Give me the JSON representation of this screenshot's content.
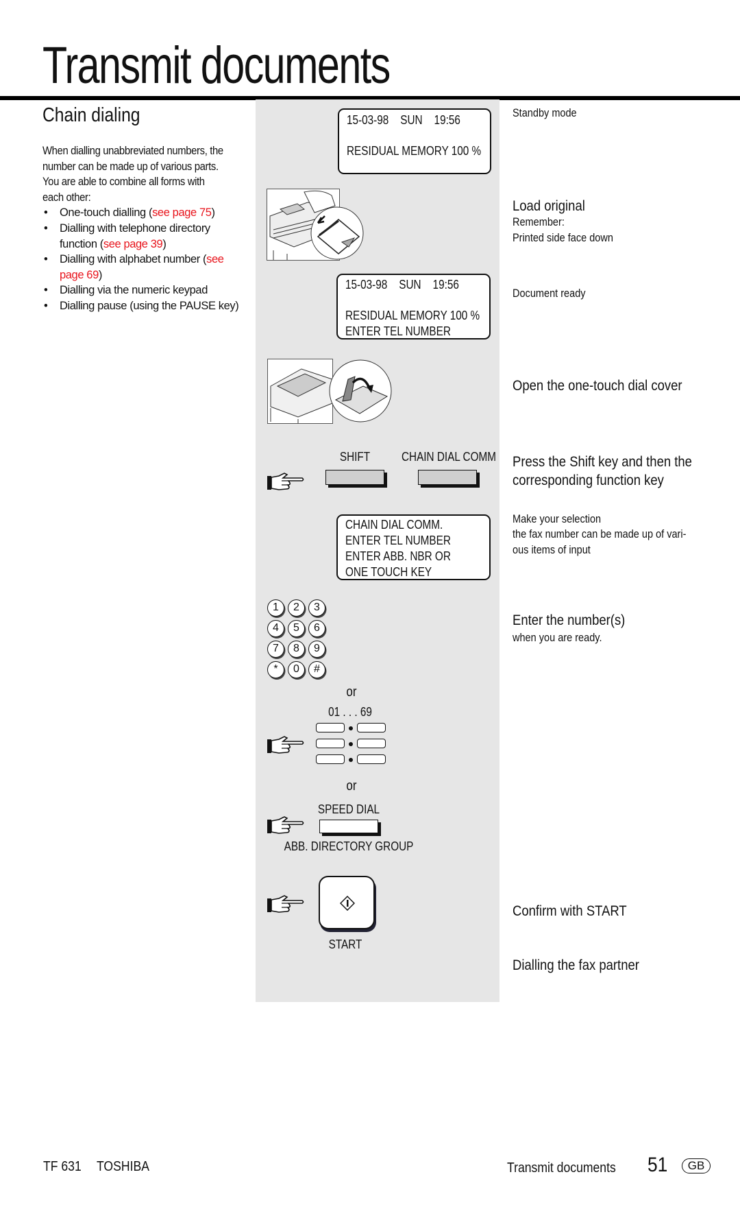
{
  "page_title": "Transmit documents",
  "section_title": "Chain dialing",
  "intro": {
    "paragraph_lines": [
      "When dialling unabbreviated numbers, the",
      "number can be made up of various parts.",
      "You are able to combine all forms with",
      "each other:"
    ],
    "bullets": [
      {
        "text": "One-touch dialling (",
        "link": "see page 75",
        "after": ")"
      },
      {
        "text": "Dialling with telephone directory",
        "line2": "function (",
        "link": "see page 39",
        "after": ")"
      },
      {
        "text": "Dialling with alphabet number (",
        "link": "see",
        "line2_link": "page 69",
        "after": ")"
      },
      {
        "text": "Dialling via the numeric keypad"
      },
      {
        "text": "Dialling pause (using the PAUSE key)"
      }
    ],
    "link_color": "#e8141c"
  },
  "displays": {
    "standby": {
      "line1": "15-03-98    SUN    19:56",
      "line2": "RESIDUAL MEMORY 100 %"
    },
    "ready": {
      "line1": "15-03-98    SUN    19:56",
      "line2": "RESIDUAL MEMORY 100 %",
      "line3": "ENTER TEL NUMBER"
    },
    "chain": {
      "line1": "CHAIN DIAL COMM.",
      "line2": "ENTER TEL NUMBER",
      "line3": "ENTER ABB. NBR OR",
      "line4": "ONE TOUCH KEY"
    }
  },
  "keys": {
    "shift": "SHIFT",
    "chain_dial": "CHAIN DIAL COMM",
    "keypad": [
      "1",
      "2",
      "3",
      "4",
      "5",
      "6",
      "7",
      "8",
      "9",
      "*",
      "0",
      "#"
    ],
    "or1": "or",
    "one_touch_range": "01 . . . 69",
    "or2": "or",
    "speed_dial": "SPEED DIAL",
    "abb_directory": "ABB. DIRECTORY GROUP",
    "start": "START"
  },
  "steps": {
    "standby": "Standby mode",
    "load_original": "Load original",
    "remember": "Remember:",
    "printed_side": "Printed side face down",
    "document_ready": "Document ready",
    "open_cover": "Open the one-touch dial cover",
    "press_shift_1": "Press the Shift key and then the",
    "press_shift_2": "corresponding function key",
    "make_selection_1": "Make your selection",
    "make_selection_2": "the fax number can be made up of vari-",
    "make_selection_3": "ous items of input",
    "enter_numbers": "Enter the number(s)",
    "when_ready": "when you are ready.",
    "confirm": "Confirm with START",
    "dialling": "Dialling the fax partner"
  },
  "footer": {
    "model": "TF 631",
    "brand": "TOSHIBA",
    "section": "Transmit documents",
    "page": "51",
    "lang": "GB"
  }
}
